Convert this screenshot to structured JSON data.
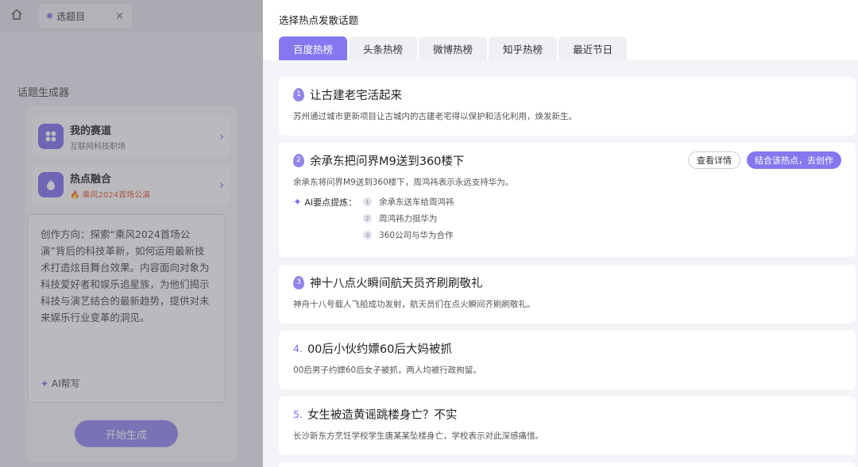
{
  "left": {
    "tab": {
      "icon": "pin-icon",
      "label": "选题目",
      "close": "×"
    },
    "home_icon": "home-icon",
    "panel_title": "话题生成器",
    "rows": [
      {
        "icon": "grid-icon",
        "title": "我的赛道",
        "subtitle": "互联网科技职场"
      },
      {
        "icon": "flame-icon",
        "title": "热点融合",
        "subtitle": "乘风2024首场公演"
      }
    ],
    "idea_text": "创作方向：探索“乘风2024首场公演”背后的科技革新，如何运用最新技术打造炫目舞台效果。内容面向对象为科技爱好者和娱乐追星族，为他们揭示科技与演艺结合的最新趋势，提供对未来娱乐行业变革的洞见。",
    "ai_help": "AI帮写",
    "generate_button": "开始生成"
  },
  "drawer": {
    "title": "选择热点发散话题",
    "tabs": [
      "百度热榜",
      "头条热榜",
      "微博热榜",
      "知乎热榜",
      "最近节日"
    ],
    "active_tab": 0,
    "topics": [
      {
        "rank": "1",
        "title": "让古建老宅活起来",
        "desc": "苏州通过城市更新项目让古城内的古建老宅得以保护和活化利用，焕发新生。"
      },
      {
        "rank": "2",
        "title": "余承东把问界M9送到360楼下",
        "desc": "余承东将问界M9送到360楼下，周鸿祎表示永远支持华为。",
        "detail_button": "查看详情",
        "create_button": "结合该热点，去创作",
        "ai_label": "AI要点提炼：",
        "points": [
          {
            "n": "1",
            "text": "余承东送车给周鸿祎"
          },
          {
            "n": "2",
            "text": "周鸿祎力挺华为"
          },
          {
            "n": "3",
            "text": "360公司与华为合作"
          }
        ]
      },
      {
        "rank": "3",
        "title": "神十八点火瞬间航天员齐刷刷敬礼",
        "desc": "神舟十八号载人飞船成功发射，航天员们在点火瞬间齐刷刷敬礼。"
      },
      {
        "rank": "4.",
        "title": "00后小伙约嫖60后大妈被抓",
        "desc": "00后男子约嫖60后女子被抓，两人均被行政拘留。"
      },
      {
        "rank": "5.",
        "title": "女生被造黄谣跳楼身亡？不实",
        "desc": "长沙新东方烹饪学校学生唐某某坠楼身亡，学校表示对此深感痛惜。"
      }
    ]
  }
}
